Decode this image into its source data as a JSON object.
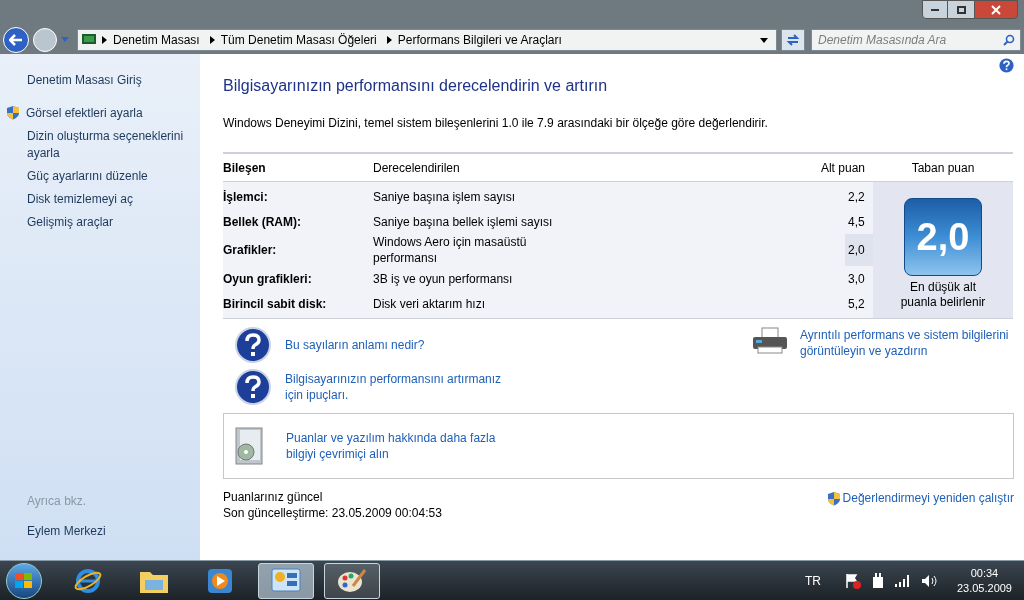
{
  "address_bar": {
    "breadcrumbs": [
      "Denetim Masası",
      "Tüm Denetim Masası Öğeleri",
      "Performans Bilgileri ve Araçları"
    ]
  },
  "search": {
    "placeholder": "Denetim Masasında Ara"
  },
  "sidebar": {
    "items": [
      {
        "label": "Denetim Masası Giriş",
        "shield": false
      },
      {
        "label": "Görsel efektleri ayarla",
        "shield": true
      },
      {
        "label": "Dizin oluşturma seçeneklerini ayarla",
        "shield": false
      },
      {
        "label": "Güç ayarlarını düzenle",
        "shield": false
      },
      {
        "label": "Disk temizlemeyi aç",
        "shield": false
      },
      {
        "label": "Gelişmiş araçlar",
        "shield": false
      }
    ],
    "see_also": {
      "heading": "Ayrıca bkz.",
      "items": [
        "Eylem Merkezi"
      ]
    }
  },
  "main": {
    "title": "Bilgisayarınızın performansını derecelendirin ve artırın",
    "description": "Windows Deneyimi Dizini, temel sistem bileşenlerini 1.0 ile 7.9 arasındaki bir ölçeğe göre değerlendirir.",
    "table": {
      "columns": [
        "Bileşen",
        "Derecelendirilen",
        "Alt puan",
        "Taban puan"
      ],
      "rows": [
        {
          "component": "İşlemci:",
          "rated": "Saniye başına işlem sayısı",
          "subscore": "2,2",
          "highlighted": false
        },
        {
          "component": "Bellek (RAM):",
          "rated": "Saniye başına bellek işlemi sayısı",
          "subscore": "4,5",
          "highlighted": false
        },
        {
          "component": "Grafikler:",
          "rated": "Windows Aero için masaüstü performansı",
          "subscore": "2,0",
          "highlighted": true
        },
        {
          "component": "Oyun grafikleri:",
          "rated": "3B iş ve oyun performansı",
          "subscore": "3,0",
          "highlighted": false
        },
        {
          "component": "Birincil sabit disk:",
          "rated": "Disk veri aktarım hızı",
          "subscore": "5,2",
          "highlighted": false
        }
      ],
      "base_score": "2,0",
      "base_caption": "En düşük alt puanla belirlenir"
    },
    "help_links": [
      "Bu sayıların anlamı nedir?",
      "Bilgisayarınızın performansını artırmanız için ipuçları."
    ],
    "print_link": "Ayrıntılı performans ve sistem bilgilerini görüntüleyin ve yazdırın",
    "online_link": "Puanlar ve yazılım hakkında daha fazla bilgiyi çevrimiçi alın",
    "status": [
      "Puanlarınız güncel",
      "Son güncelleştirme: 23.05.2009 00:04:53"
    ],
    "rerun_link": "Değerlendirmeyi yeniden çalıştır"
  },
  "taskbar": {
    "buttons": [
      {
        "kind": "ie",
        "selected": false,
        "running": false
      },
      {
        "kind": "explorer",
        "selected": false,
        "running": false
      },
      {
        "kind": "media",
        "selected": false,
        "running": false
      },
      {
        "kind": "control",
        "selected": true,
        "running": true
      },
      {
        "kind": "paint",
        "selected": false,
        "running": true
      }
    ],
    "language": "TR",
    "time": "00:34",
    "date": "23.05.2009"
  }
}
